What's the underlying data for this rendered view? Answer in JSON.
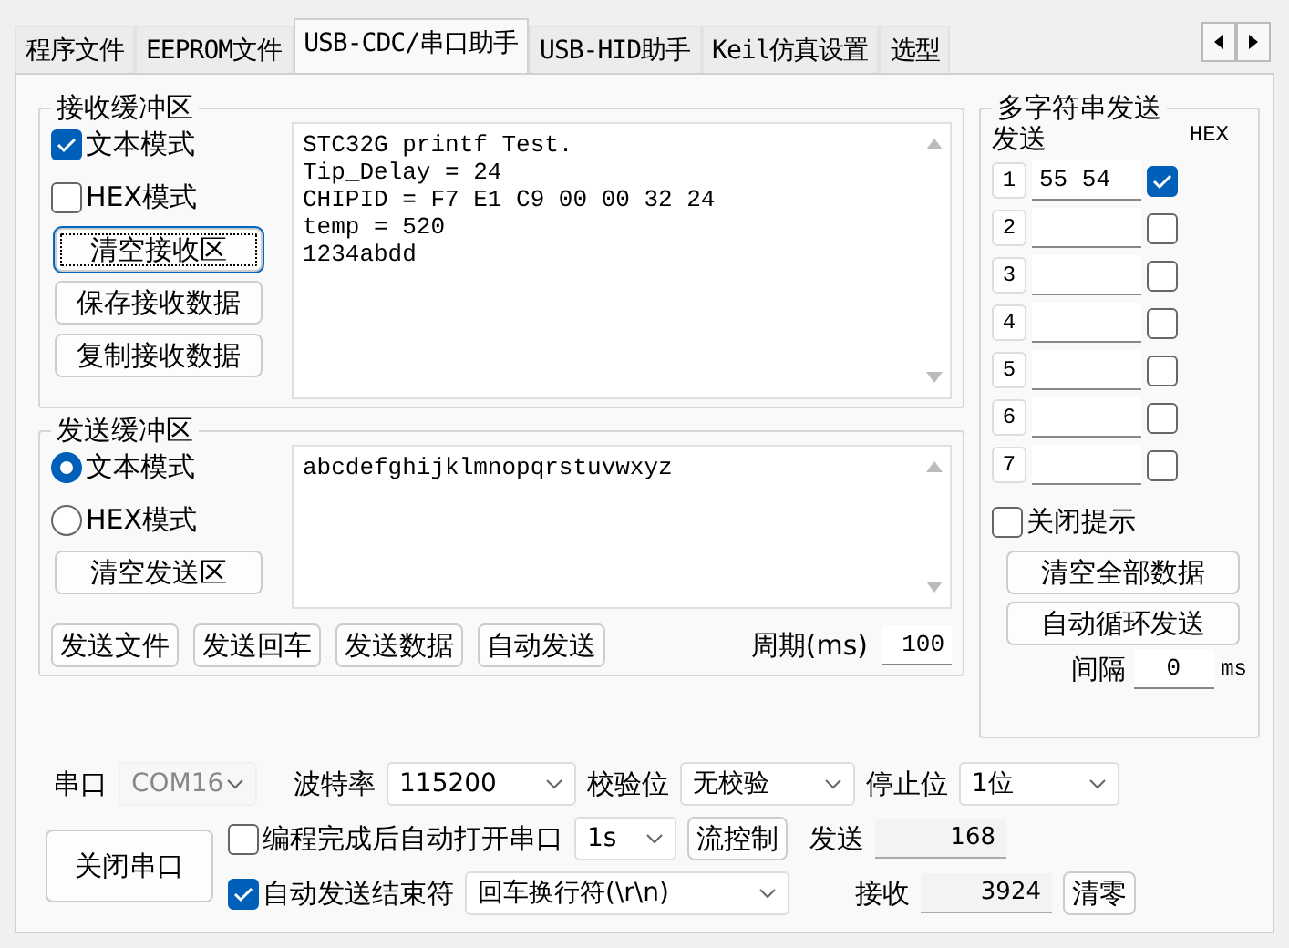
{
  "tabs": [
    {
      "label": "程序文件",
      "selected": false
    },
    {
      "label": "EEPROM文件",
      "selected": false
    },
    {
      "label": "USB-CDC/串口助手",
      "selected": true
    },
    {
      "label": "USB-HID助手",
      "selected": false
    },
    {
      "label": "Keil仿真设置",
      "selected": false
    },
    {
      "label": "选型",
      "selected": false
    }
  ],
  "receive": {
    "title": "接收缓冲区",
    "modes": [
      {
        "label": "文本模式",
        "checked": true
      },
      {
        "label": "HEX模式",
        "checked": false
      }
    ],
    "buttons": [
      {
        "label": "清空接收区",
        "focused": true
      },
      {
        "label": "保存接收数据",
        "focused": false
      },
      {
        "label": "复制接收数据",
        "focused": false
      }
    ],
    "lines": [
      "STC32G printf Test.",
      "Tip_Delay = 24",
      "CHIPID = F7 E1 C9 00 00 32 24",
      "temp = 520",
      "1234abdd"
    ]
  },
  "send": {
    "title": "发送缓冲区",
    "modes": [
      {
        "label": "文本模式",
        "selected": true
      },
      {
        "label": "HEX模式",
        "selected": false
      }
    ],
    "clear_button": "清空发送区",
    "text": "abcdefghijklmnopqrstuvwxyz",
    "actions": [
      "发送文件",
      "发送回车",
      "发送数据",
      "自动发送"
    ],
    "period_label": "周期(ms)",
    "period_value": "100"
  },
  "multi": {
    "title": "多字符串发送",
    "send_header": "发送",
    "hex_header": "HEX",
    "rows": [
      {
        "number": "1",
        "value": "55 54",
        "hex": true
      },
      {
        "number": "2",
        "value": "",
        "hex": false
      },
      {
        "number": "3",
        "value": "",
        "hex": false
      },
      {
        "number": "4",
        "value": "",
        "hex": false
      },
      {
        "number": "5",
        "value": "",
        "hex": false
      },
      {
        "number": "6",
        "value": "",
        "hex": false
      },
      {
        "number": "7",
        "value": "",
        "hex": false
      }
    ],
    "close_hint": {
      "label": "关闭提示",
      "checked": false
    },
    "buttons": [
      "清空全部数据",
      "自动循环发送"
    ],
    "interval_label": "间隔",
    "interval_value": "0",
    "interval_unit": "ms"
  },
  "bottom": {
    "port": {
      "label": "串口",
      "value": "COM16",
      "disabled": true
    },
    "baud": {
      "label": "波特率",
      "value": "115200",
      "disabled": false
    },
    "parity": {
      "label": "校验位",
      "value": "无校验",
      "disabled": false
    },
    "stop": {
      "label": "停止位",
      "value": "1位",
      "disabled": false
    },
    "close_button": "关闭串口",
    "auto_open": {
      "label": "编程完成后自动打开串口",
      "checked": false
    },
    "delay": "1s",
    "flow_button": "流控制",
    "sent_label": "发送",
    "sent_value": "168",
    "auto_end": {
      "label": "自动发送结束符",
      "checked": true
    },
    "end_value": "回车换行符(\\r\\n)",
    "recv_label": "接收",
    "recv_value": "3924",
    "clear_button": "清零"
  }
}
